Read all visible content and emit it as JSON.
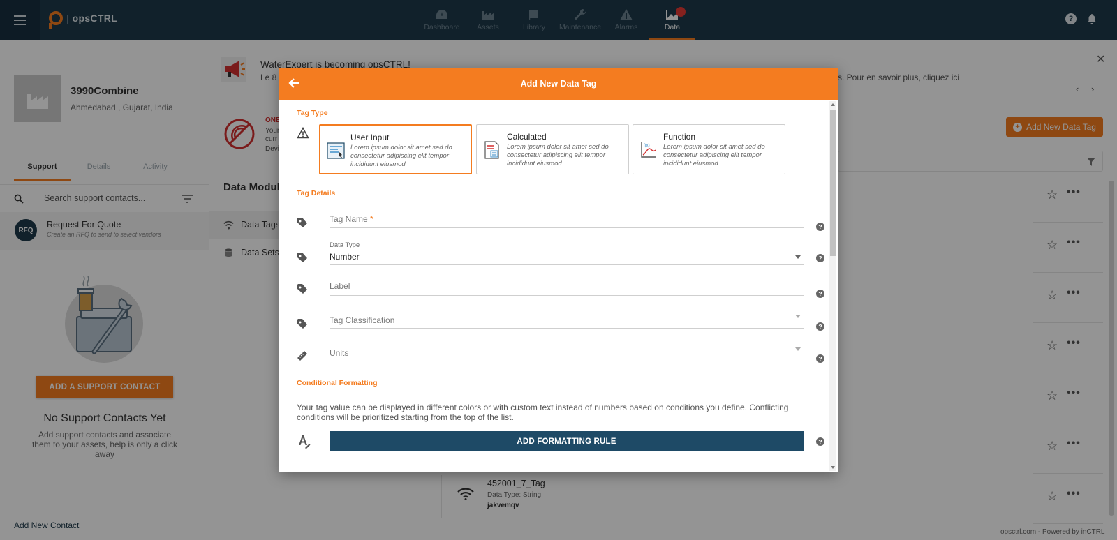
{
  "app": {
    "logo_text": "opsCTRL",
    "logo_sep": "|",
    "nav": [
      {
        "label": "Dashboard",
        "icon": "dashboard-icon"
      },
      {
        "label": "Assets",
        "icon": "factory-icon"
      },
      {
        "label": "Library",
        "icon": "book-icon"
      },
      {
        "label": "Maintenance",
        "icon": "wrench-icon"
      },
      {
        "label": "Alarms",
        "icon": "warning-icon"
      },
      {
        "label": "Data",
        "icon": "chart-icon",
        "active": true
      }
    ],
    "help_glyph": "?",
    "accent": "#f47c20",
    "topbar_color": "#1e3a4a"
  },
  "sidebar": {
    "site_name": "3990Combine",
    "site_location": "Ahmedabad , Gujarat, India",
    "tabs": [
      "Support",
      "Details",
      "Activity"
    ],
    "search_placeholder": "Search support contacts...",
    "rfq": {
      "badge": "RFQ",
      "title": "Request For Quote",
      "subtitle": "Create an RFQ to send to select vendors"
    },
    "add_contact_button": "ADD A SUPPORT CONTACT",
    "empty_title": "No Support Contacts Yet",
    "empty_text": "Add support contacts and associate them to your assets, help is only a click away",
    "footer_link": "Add New Contact"
  },
  "main": {
    "announcement": {
      "title": "WaterExpert is becoming opsCTRL!",
      "body": "Le 8 c",
      "more": "s. Pour en savoir plus, cliquez ici",
      "close": "✕",
      "prev": "‹",
      "next": "›"
    },
    "warning": {
      "line1": "ONE",
      "line2": "Your",
      "line3": "curr",
      "line4": "Devi"
    },
    "add_tag_button": "Add New Data Tag",
    "data_modules_title": "Data Modules",
    "modules": [
      {
        "label": "Data Tags",
        "active": true
      },
      {
        "label": "Data Sets",
        "active": false
      }
    ],
    "visible_tag": {
      "name": "452001_7_Tag",
      "data_type": "Data Type: String",
      "value": "jakvemqv"
    },
    "row_star": "☆",
    "row_dots": "•••",
    "footer_credit": "opsctrl.com - Powered by inCTRL"
  },
  "modal": {
    "title": "Add New Data Tag",
    "tag_type_label": "Tag Type",
    "types": [
      {
        "title": "User Input",
        "desc": "Lorem ipsum dolor sit amet sed do consectetur adipiscing elit tempor incididunt eiusmod",
        "selected": true
      },
      {
        "title": "Calculated",
        "desc": "Lorem ipsum dolor sit amet sed do consectetur adipiscing elit tempor incididunt eiusmod",
        "selected": false
      },
      {
        "title": "Function",
        "desc": "Lorem ipsum dolor sit amet sed do consectetur adipiscing elit tempor incididunt eiusmod",
        "selected": false
      }
    ],
    "tag_details_label": "Tag Details",
    "fields": {
      "tag_name": {
        "label": "Tag Name",
        "required_mark": "*"
      },
      "data_type": {
        "label": "Data Type",
        "value": "Number"
      },
      "label": {
        "label": "Label"
      },
      "tag_classification": {
        "label": "Tag Classification"
      },
      "units": {
        "label": "Units"
      }
    },
    "help_glyph": "?",
    "conditional_label": "Conditional Formatting",
    "conditional_text": "Your tag value can be displayed in different colors or with custom text instead of numbers based on conditions you define. Conflicting conditions will be prioritized starting from the top of the list.",
    "add_rule_button": "ADD FORMATTING RULE"
  }
}
